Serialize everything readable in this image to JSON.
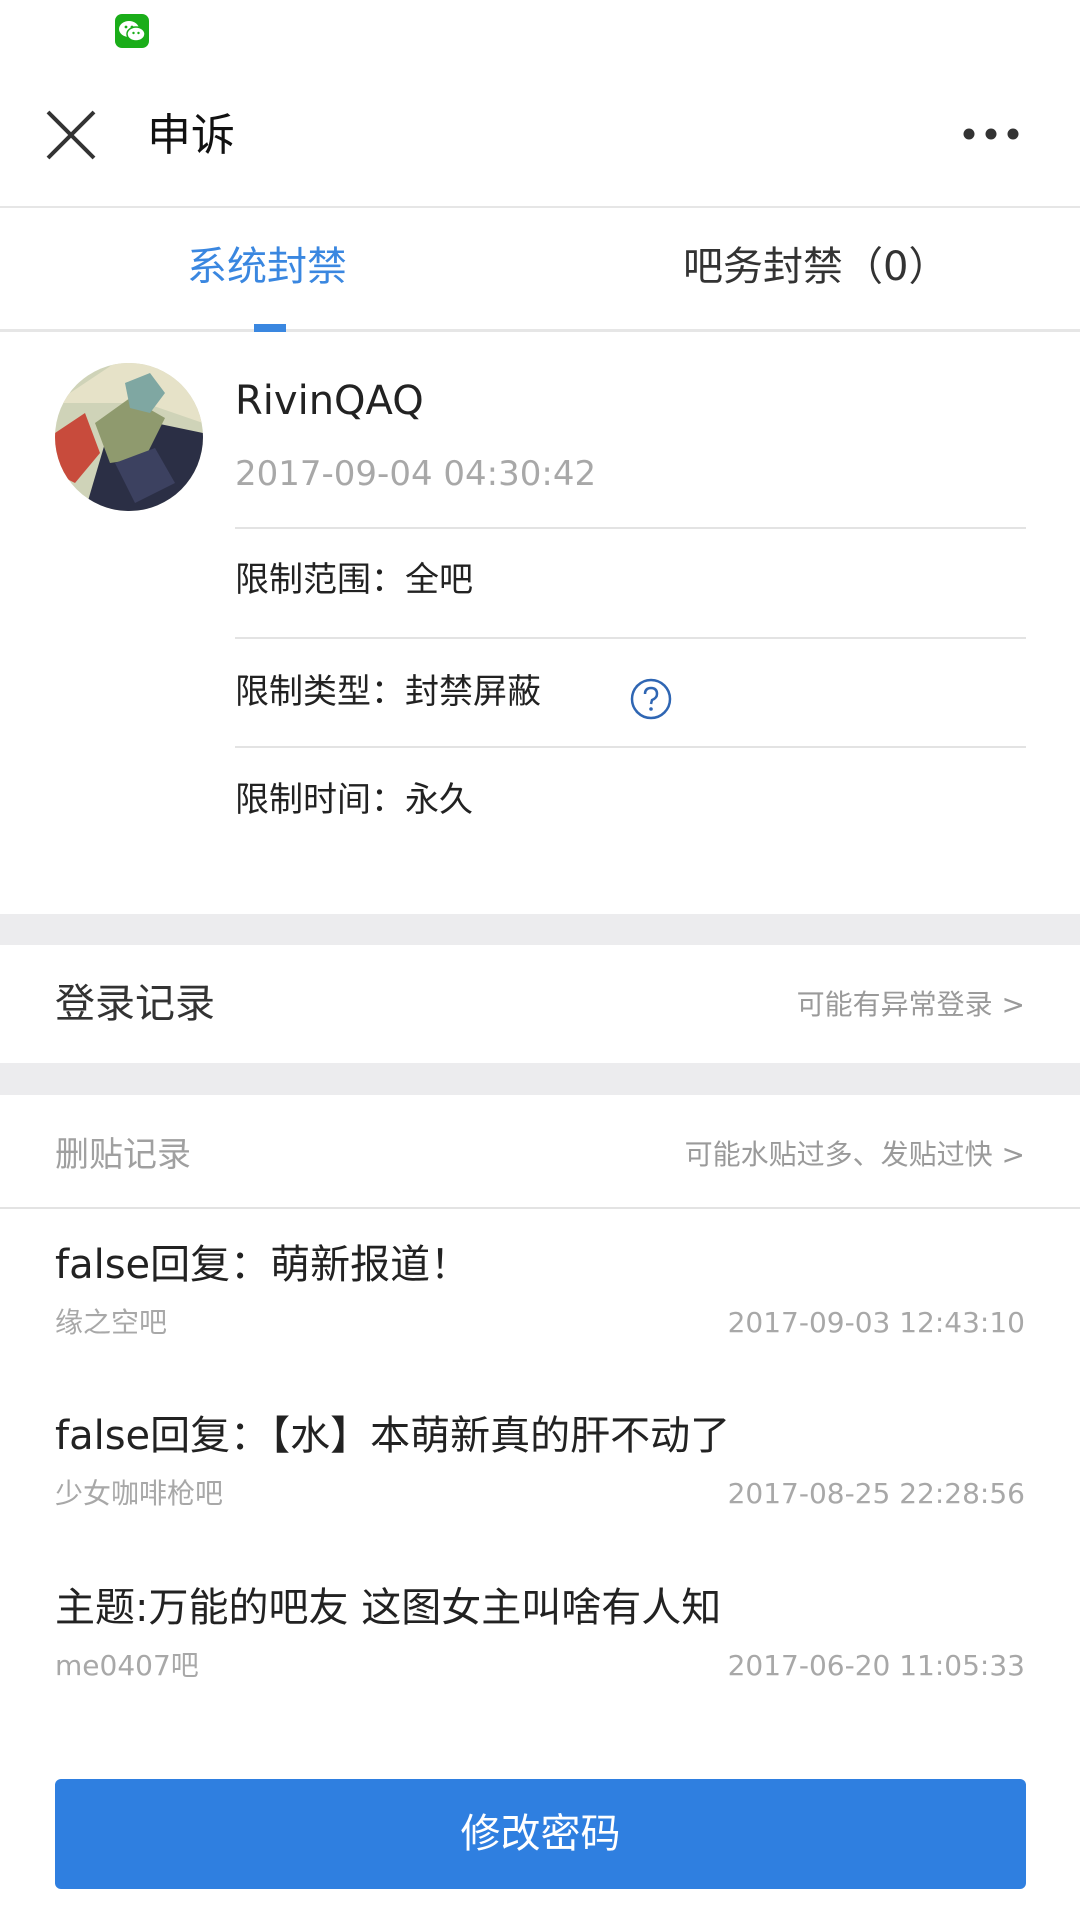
{
  "nav": {
    "title": "申诉"
  },
  "tabs": [
    {
      "label": "系统封禁"
    },
    {
      "label": "吧务封禁（0）"
    }
  ],
  "ban": {
    "username": "RivinQAQ",
    "time": "2017-09-04 04:30:42",
    "scope": "限制范围：全吧",
    "type": "限制类型：封禁屏蔽",
    "duration": "限制时间：永久"
  },
  "login_record": {
    "title": "登录记录",
    "hint": "可能有异常登录 >"
  },
  "deleted_posts": {
    "title": "删贴记录",
    "hint": "可能水贴过多、发贴过快 >",
    "items": [
      {
        "title": "false回复：萌新报道！",
        "forum": "缘之空吧",
        "date": "2017-09-03 12:43:10"
      },
      {
        "title": "false回复：【水】本萌新真的肝不动了",
        "forum": "少女咖啡枪吧",
        "date": "2017-08-25 22:28:56"
      },
      {
        "title": "主题:万能的吧友 这图女主叫啥有人知",
        "forum": "me0407吧",
        "date": "2017-06-20 11:05:33"
      }
    ]
  },
  "actions": {
    "change_password": "修改密码"
  },
  "colors": {
    "accent": "#3a87e0",
    "button": "#2f7fe0",
    "wechat": "#1aad19"
  },
  "icons": [
    "wechat-icon",
    "close-icon",
    "more-icon",
    "help-icon"
  ]
}
